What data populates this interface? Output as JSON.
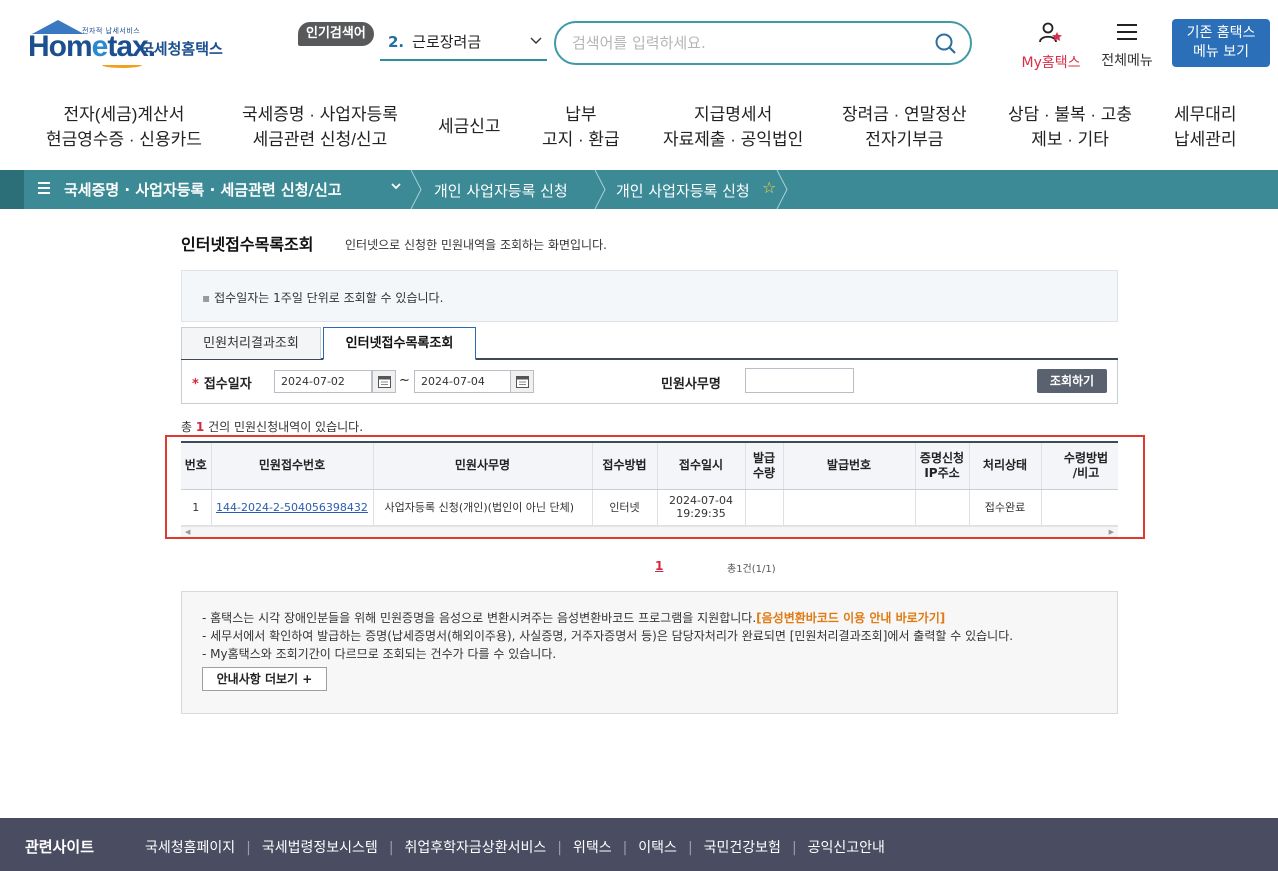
{
  "header": {
    "logo": {
      "subtitle": "전자적 납세서비스",
      "brand_a": "Hom",
      "brand_e": "e",
      "brand_b": "tax.",
      "nts": "국세청홈택스"
    },
    "popular": {
      "badge": "인기검색어",
      "rank": "2.",
      "keyword": "근로장려금"
    },
    "search": {
      "placeholder": "검색어를 입력하세요."
    },
    "my_hometax": "My홈택스",
    "all_menu": "전체메뉴",
    "old_menu": {
      "line1": "기존 홈택스",
      "line2": "메뉴 보기"
    }
  },
  "gnb": [
    {
      "l1": "전자(세금)계산서",
      "l2": "현금영수증 · 신용카드"
    },
    {
      "l1": "국세증명 · 사업자등록",
      "l2": "세금관련 신청/신고"
    },
    {
      "l1": "세금신고",
      "l2": ""
    },
    {
      "l1": "납부",
      "l2": "고지 · 환급"
    },
    {
      "l1": "지급명세서",
      "l2": "자료제출 · 공익법인"
    },
    {
      "l1": "장려금 · 연말정산",
      "l2": "전자기부금"
    },
    {
      "l1": "상담 · 불복 · 고충",
      "l2": "제보 · 기타"
    },
    {
      "l1": "세무대리",
      "l2": "납세관리"
    }
  ],
  "breadcrumb": {
    "level1": "국세증명 · 사업자등록 · 세금관련 신청/신고",
    "level2": "개인 사업자등록 신청",
    "level3": "개인 사업자등록 신청"
  },
  "page": {
    "title": "인터넷접수목록조회",
    "description": "인터넷으로 신청한 민원내역을 조회하는 화면입니다.",
    "notice": "접수일자는 1주일 단위로 조회할 수 있습니다."
  },
  "tabs": [
    {
      "label": "민원처리결과조회"
    },
    {
      "label": "인터넷접수목록조회"
    }
  ],
  "search_form": {
    "date_label": "접수일자",
    "required_mark": "*",
    "date_from": "2024-07-02",
    "tilde": "~",
    "date_to": "2024-07-04",
    "civil_name_label": "민원사무명",
    "civil_name_value": "",
    "query_button": "조회하기"
  },
  "result": {
    "count_prefix": "총",
    "count": "1",
    "count_suffix": "건의 민원신청내역이 있습니다.",
    "columns": {
      "no": "번호",
      "receipt_no": "민원접수번호",
      "civil_name": "민원사무명",
      "method": "접수방법",
      "date": "접수일시",
      "qty_1": "발급",
      "qty_2": "수량",
      "issue_no": "발급번호",
      "ip_1": "증명신청",
      "ip_2": "IP주소",
      "status": "처리상태",
      "receive_1": "수령방법",
      "receive_2": "/비고"
    },
    "rows": [
      {
        "no": "1",
        "receipt_no": "144-2024-2-504056398432",
        "civil_name": "사업자등록 신청(개인)(법인이 아닌 단체)",
        "method": "인터넷",
        "date_1": "2024-07-04",
        "date_2": "19:29:35",
        "qty": "",
        "issue_no": "",
        "ip": "",
        "status": "접수완료",
        "receive": ""
      }
    ]
  },
  "pagination": {
    "current": "1",
    "total": "총1건(1/1)"
  },
  "info": {
    "line1_text": "- 홈택스는 시각 장애인분들을 위해 민원증명을 음성으로 변환시켜주는 음성변환바코드 프로그램을 지원합니다.",
    "line1_link": "[음성변환바코드 이용 안내 바로가기]",
    "line2": "- 세무서에서 확인하여 발급하는 증명(납세증명서(해외이주용), 사실증명, 거주자증명서 등)은 담당자처리가 완료되면 [민원처리결과조회]에서 출력할 수 있습니다.",
    "line3": "- My홈택스와 조회기간이 다르므로 조회되는 건수가 다를 수 있습니다.",
    "more_button": "안내사항 더보기 +"
  },
  "footer": {
    "title": "관련사이트",
    "links": [
      "국세청홈페이지",
      "국세법령정보시스템",
      "취업후학자금상환서비스",
      "위택스",
      "이택스",
      "국민건강보험",
      "공익신고안내"
    ]
  },
  "colors": {
    "breadcrumb_bg": "#3b8a95",
    "primary_blue": "#2b6fb8",
    "highlight_red": "#e03a2e",
    "footer_bg": "#4a4d62"
  }
}
